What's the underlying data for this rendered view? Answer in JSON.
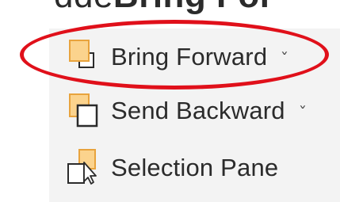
{
  "header": {
    "cropped_text_prefix": "dde",
    "cropped_text_bold": "Bring For"
  },
  "menu": {
    "items": [
      {
        "label": "Bring Forward",
        "icon": "bring-forward-icon",
        "has_dropdown": true,
        "highlighted": true
      },
      {
        "label": "Send Backward",
        "icon": "send-backward-icon",
        "has_dropdown": true
      },
      {
        "label": "Selection Pane",
        "icon": "selection-pane-icon",
        "has_dropdown": false
      }
    ],
    "chevron": "˅"
  },
  "colors": {
    "annotation_oval": "#e0101a",
    "icon_fill": "#fbd38d",
    "icon_stroke": "#e8a33d",
    "panel_background": "#f3f3f3",
    "text": "#2b2b2b"
  }
}
